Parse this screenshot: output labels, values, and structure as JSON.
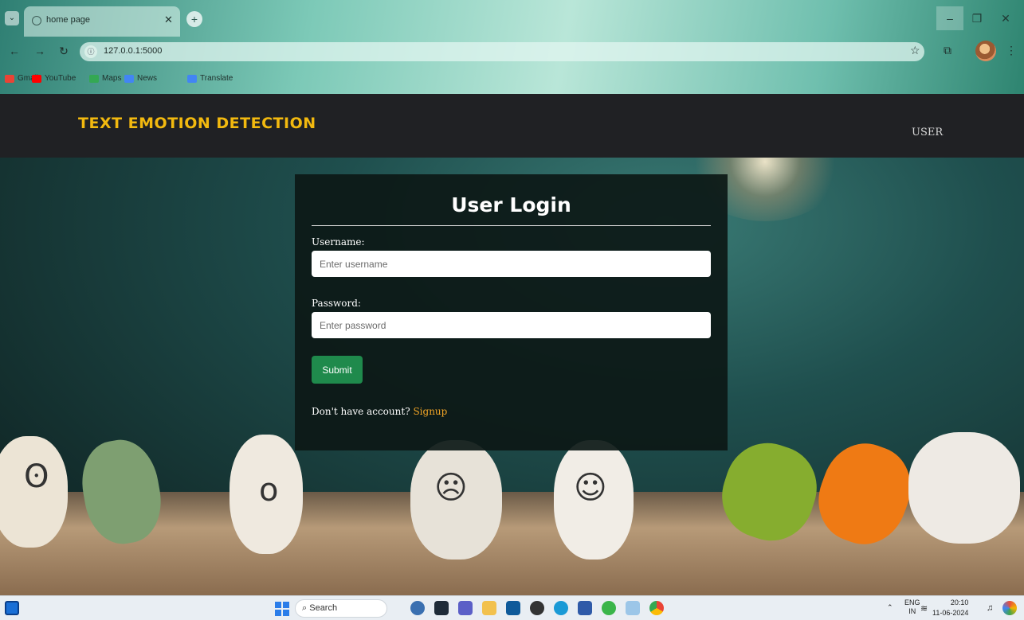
{
  "browser": {
    "tab_title": "home page",
    "url": "127.0.0.1:5000",
    "bookmarks": [
      {
        "label": "Gmail",
        "color": "#ea4335"
      },
      {
        "label": "YouTube",
        "color": "#ff0000"
      },
      {
        "label": "Maps",
        "color": "#34a853"
      },
      {
        "label": "News",
        "color": "#4285f4"
      },
      {
        "label": "Translate",
        "color": "#4285f4"
      }
    ]
  },
  "header": {
    "brand": "TEXT EMOTION DETECTION",
    "nav_user": "USER",
    "brand_color": "#f2b90f"
  },
  "login": {
    "title": "User Login",
    "username_label": "Username:",
    "username_placeholder": "Enter username",
    "password_label": "Password:",
    "password_placeholder": "Enter password",
    "submit_label": "Submit",
    "signup_prompt": "Don't have account?",
    "signup_link": "Signup",
    "link_color": "#f2a526",
    "button_color": "#1f8a4c"
  },
  "taskbar": {
    "search_label": "Search",
    "language_top": "ENG",
    "language_bottom": "IN",
    "time": "20:10",
    "date": "11-06-2024"
  }
}
